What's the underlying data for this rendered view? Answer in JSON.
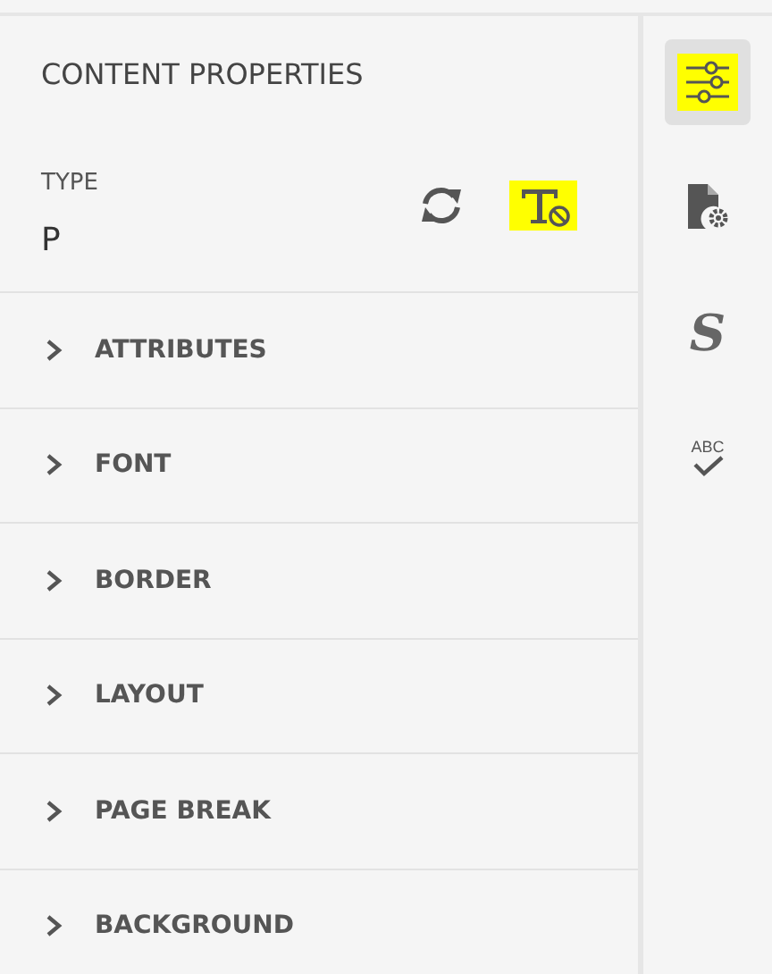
{
  "panel": {
    "title": "CONTENT PROPERTIES",
    "type_label": "TYPE",
    "type_value": "P",
    "actions": [
      {
        "kind": "refresh",
        "highlighted": false
      },
      {
        "kind": "clear-format",
        "highlighted": true
      }
    ],
    "sections": [
      {
        "label": "ATTRIBUTES",
        "expanded": false
      },
      {
        "label": "FONT",
        "expanded": false
      },
      {
        "label": "BORDER",
        "expanded": false
      },
      {
        "label": "LAYOUT",
        "expanded": false
      },
      {
        "label": "PAGE BREAK",
        "expanded": false
      },
      {
        "label": "BACKGROUND",
        "expanded": false
      }
    ]
  },
  "rail": [
    {
      "kind": "sliders",
      "selected": true,
      "highlighted": true
    },
    {
      "kind": "file-gear",
      "selected": false,
      "highlighted": false
    },
    {
      "kind": "glyph",
      "glyph": "S",
      "selected": false,
      "highlighted": false
    },
    {
      "kind": "spellcheck",
      "glyph": "ABC",
      "selected": false,
      "highlighted": false
    }
  ]
}
